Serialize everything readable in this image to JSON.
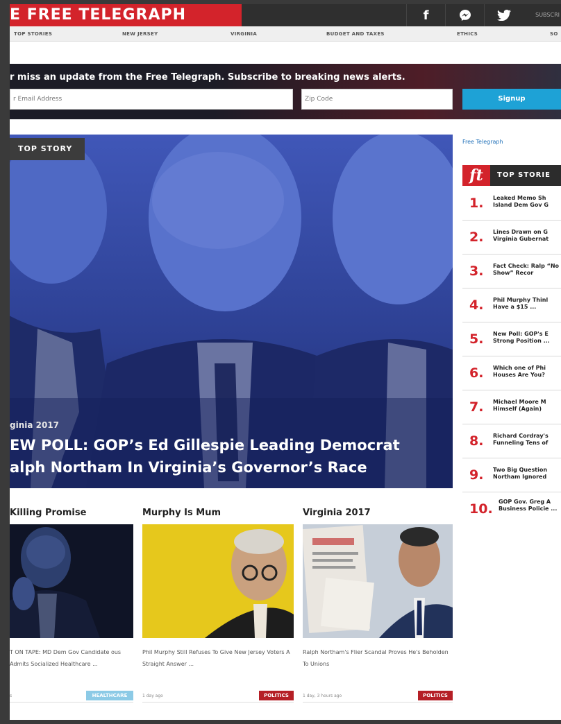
{
  "header": {
    "brand": "E FREE TELEGRAPH",
    "subscribe": "SUBSCRI",
    "social": [
      {
        "icon": "facebook-icon",
        "glyph": "f"
      },
      {
        "icon": "messenger-icon",
        "glyph": "m"
      },
      {
        "icon": "twitter-icon",
        "glyph": "t"
      }
    ]
  },
  "nav": [
    "TOP STORIES",
    "NEW JERSEY",
    "VIRGINIA",
    "BUDGET AND TAXES",
    "ETHICS",
    "SO"
  ],
  "signup": {
    "text": "r miss an update from the Free Telegraph. Subscribe to breaking news alerts.",
    "email_placeholder": "r Email Address",
    "zip_placeholder": "Zip Code",
    "button": "Signup"
  },
  "hero": {
    "tag": "TOP STORY",
    "category": "ginia 2017",
    "title_line1": "EW POLL: GOP’s Ed Gillespie Leading Democrat",
    "title_line2": "alph Northam In Virginia’s Governor’s Race"
  },
  "sidebar": {
    "link": "Free Telegraph",
    "heading": "TOP STORIE",
    "items": [
      {
        "num": "1.",
        "title": "Leaked Memo Sh Island Dem Gov G"
      },
      {
        "num": "2.",
        "title": "Lines Drawn on G Virginia Gubernat"
      },
      {
        "num": "3.",
        "title": "Fact Check: Ralp “No Show” Recor"
      },
      {
        "num": "4.",
        "title": "Phil Murphy Thinl Have a $15 ..."
      },
      {
        "num": "5.",
        "title": "New Poll: GOP's E Strong Position ..."
      },
      {
        "num": "6.",
        "title": "Which one of Phi Houses Are You?"
      },
      {
        "num": "7.",
        "title": "Michael Moore M Himself (Again)"
      },
      {
        "num": "8.",
        "title": "Richard Cordray's Funneling Tens of"
      },
      {
        "num": "9.",
        "title": "Two Big Question Northam Ignored"
      },
      {
        "num": "10.",
        "title": "GOP Gov. Greg A Business Policie ..."
      }
    ]
  },
  "cards": [
    {
      "heading": "Killing Promise",
      "desc": "T ON TAPE: MD Dem Gov Candidate ous Admits Socialized Healthcare ...",
      "meta": "s",
      "tag": "HEALTHCARE",
      "tag_color": "#8ccae6"
    },
    {
      "heading": "Murphy Is Mum",
      "desc": "Phil Murphy Still Refuses To Give New Jersey Voters A Straight Answer ...",
      "meta": "1 day ago",
      "tag": "POLITICS",
      "tag_color": "#b51f26"
    },
    {
      "heading": "Virginia 2017",
      "desc": "Ralph Northam's Flier Scandal Proves He's Beholden To Unions",
      "meta": "1 day, 3 hours ago",
      "tag": "POLITICS",
      "tag_color": "#b51f26"
    }
  ]
}
